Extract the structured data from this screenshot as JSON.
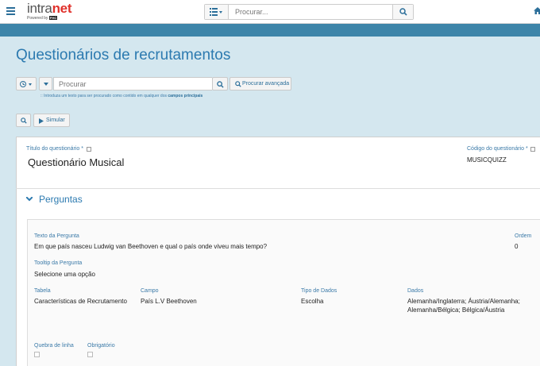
{
  "app": {
    "logo_part1": "intra",
    "logo_part2": "net",
    "powered_by": "Powered by",
    "powered_brand": "PHC"
  },
  "topbar": {
    "search_placeholder": "Procurar..."
  },
  "page": {
    "title": "Questionários de recrutamentos"
  },
  "search": {
    "placeholder": "Procurar",
    "advanced_label": "Procurar avançada",
    "hint_prefix": ":: Introduza um texto para ser procurado como contido em qualquer dos ",
    "hint_bold": "campos principais"
  },
  "toolbar": {
    "simulate_label": "Simular"
  },
  "form": {
    "title_label": "Título do questionário *",
    "title_value": "Questionário Musical",
    "code_label": "Código do questionário *",
    "code_value": "MUSICQUIZZ"
  },
  "questions": {
    "section_title": "Perguntas",
    "text_label": "Texto da Pergunta",
    "text_value": "Em que país nasceu Ludwig van Beethoven e qual o país onde viveu mais tempo?",
    "order_label": "Ordem",
    "order_value": "0",
    "tooltip_label": "Tooltip da Pergunta",
    "tooltip_value": "Selecione uma opção",
    "table_label": "Tabela",
    "table_value": "Características de Recrutamento",
    "field_label": "Campo",
    "field_value": "País L.V Beethoven",
    "type_label": "Tipo de Dados",
    "type_value": "Escolha",
    "data_label": "Dados",
    "data_line1": "Alemanha/Inglaterra; Áustria/Alemanha;",
    "data_line2": "Alemanha/Bélgica; Bélgica/Áustria",
    "linebreak_label": "Quebra de linha",
    "required_label": "Obrigatório"
  }
}
